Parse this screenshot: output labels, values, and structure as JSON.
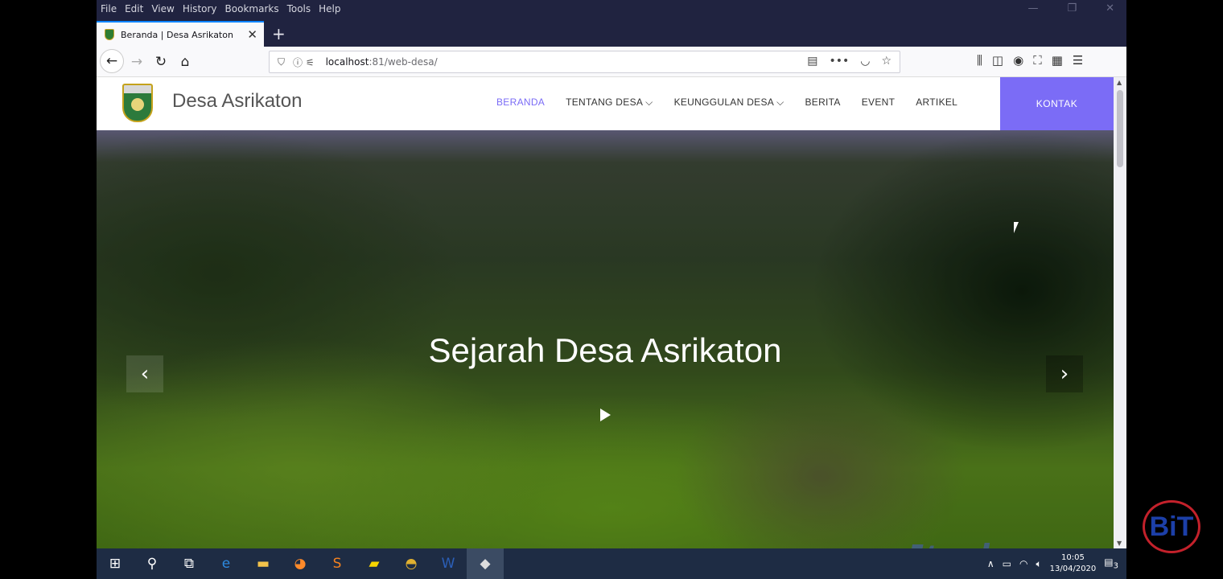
{
  "menubar": {
    "items": [
      "File",
      "Edit",
      "View",
      "History",
      "Bookmarks",
      "Tools",
      "Help"
    ]
  },
  "tab": {
    "title": "Beranda | Desa Asrikaton"
  },
  "urlbar": {
    "host": "localhost",
    "path": ":81/web-desa/"
  },
  "site": {
    "brand": "Desa Asrikaton",
    "nav": [
      {
        "label": "BERANDA",
        "active": true
      },
      {
        "label": "TENTANG DESA ⌵"
      },
      {
        "label": "KEUNGGULAN DESA ⌵"
      },
      {
        "label": "BERITA"
      },
      {
        "label": "EVENT"
      },
      {
        "label": "ARTIKEL"
      }
    ],
    "cta": "KONTAK",
    "hero_title": "Sejarah Desa Asrikaton",
    "watermark": "Jtech"
  },
  "taskbar": {
    "time": "10:05",
    "date": "13/04/2020",
    "notifications": "3"
  },
  "overlay_logo": "BiT",
  "colors": {
    "accent": "#7b6cf6",
    "browser_dark": "#202340",
    "taskbar": "#1e2c44"
  }
}
